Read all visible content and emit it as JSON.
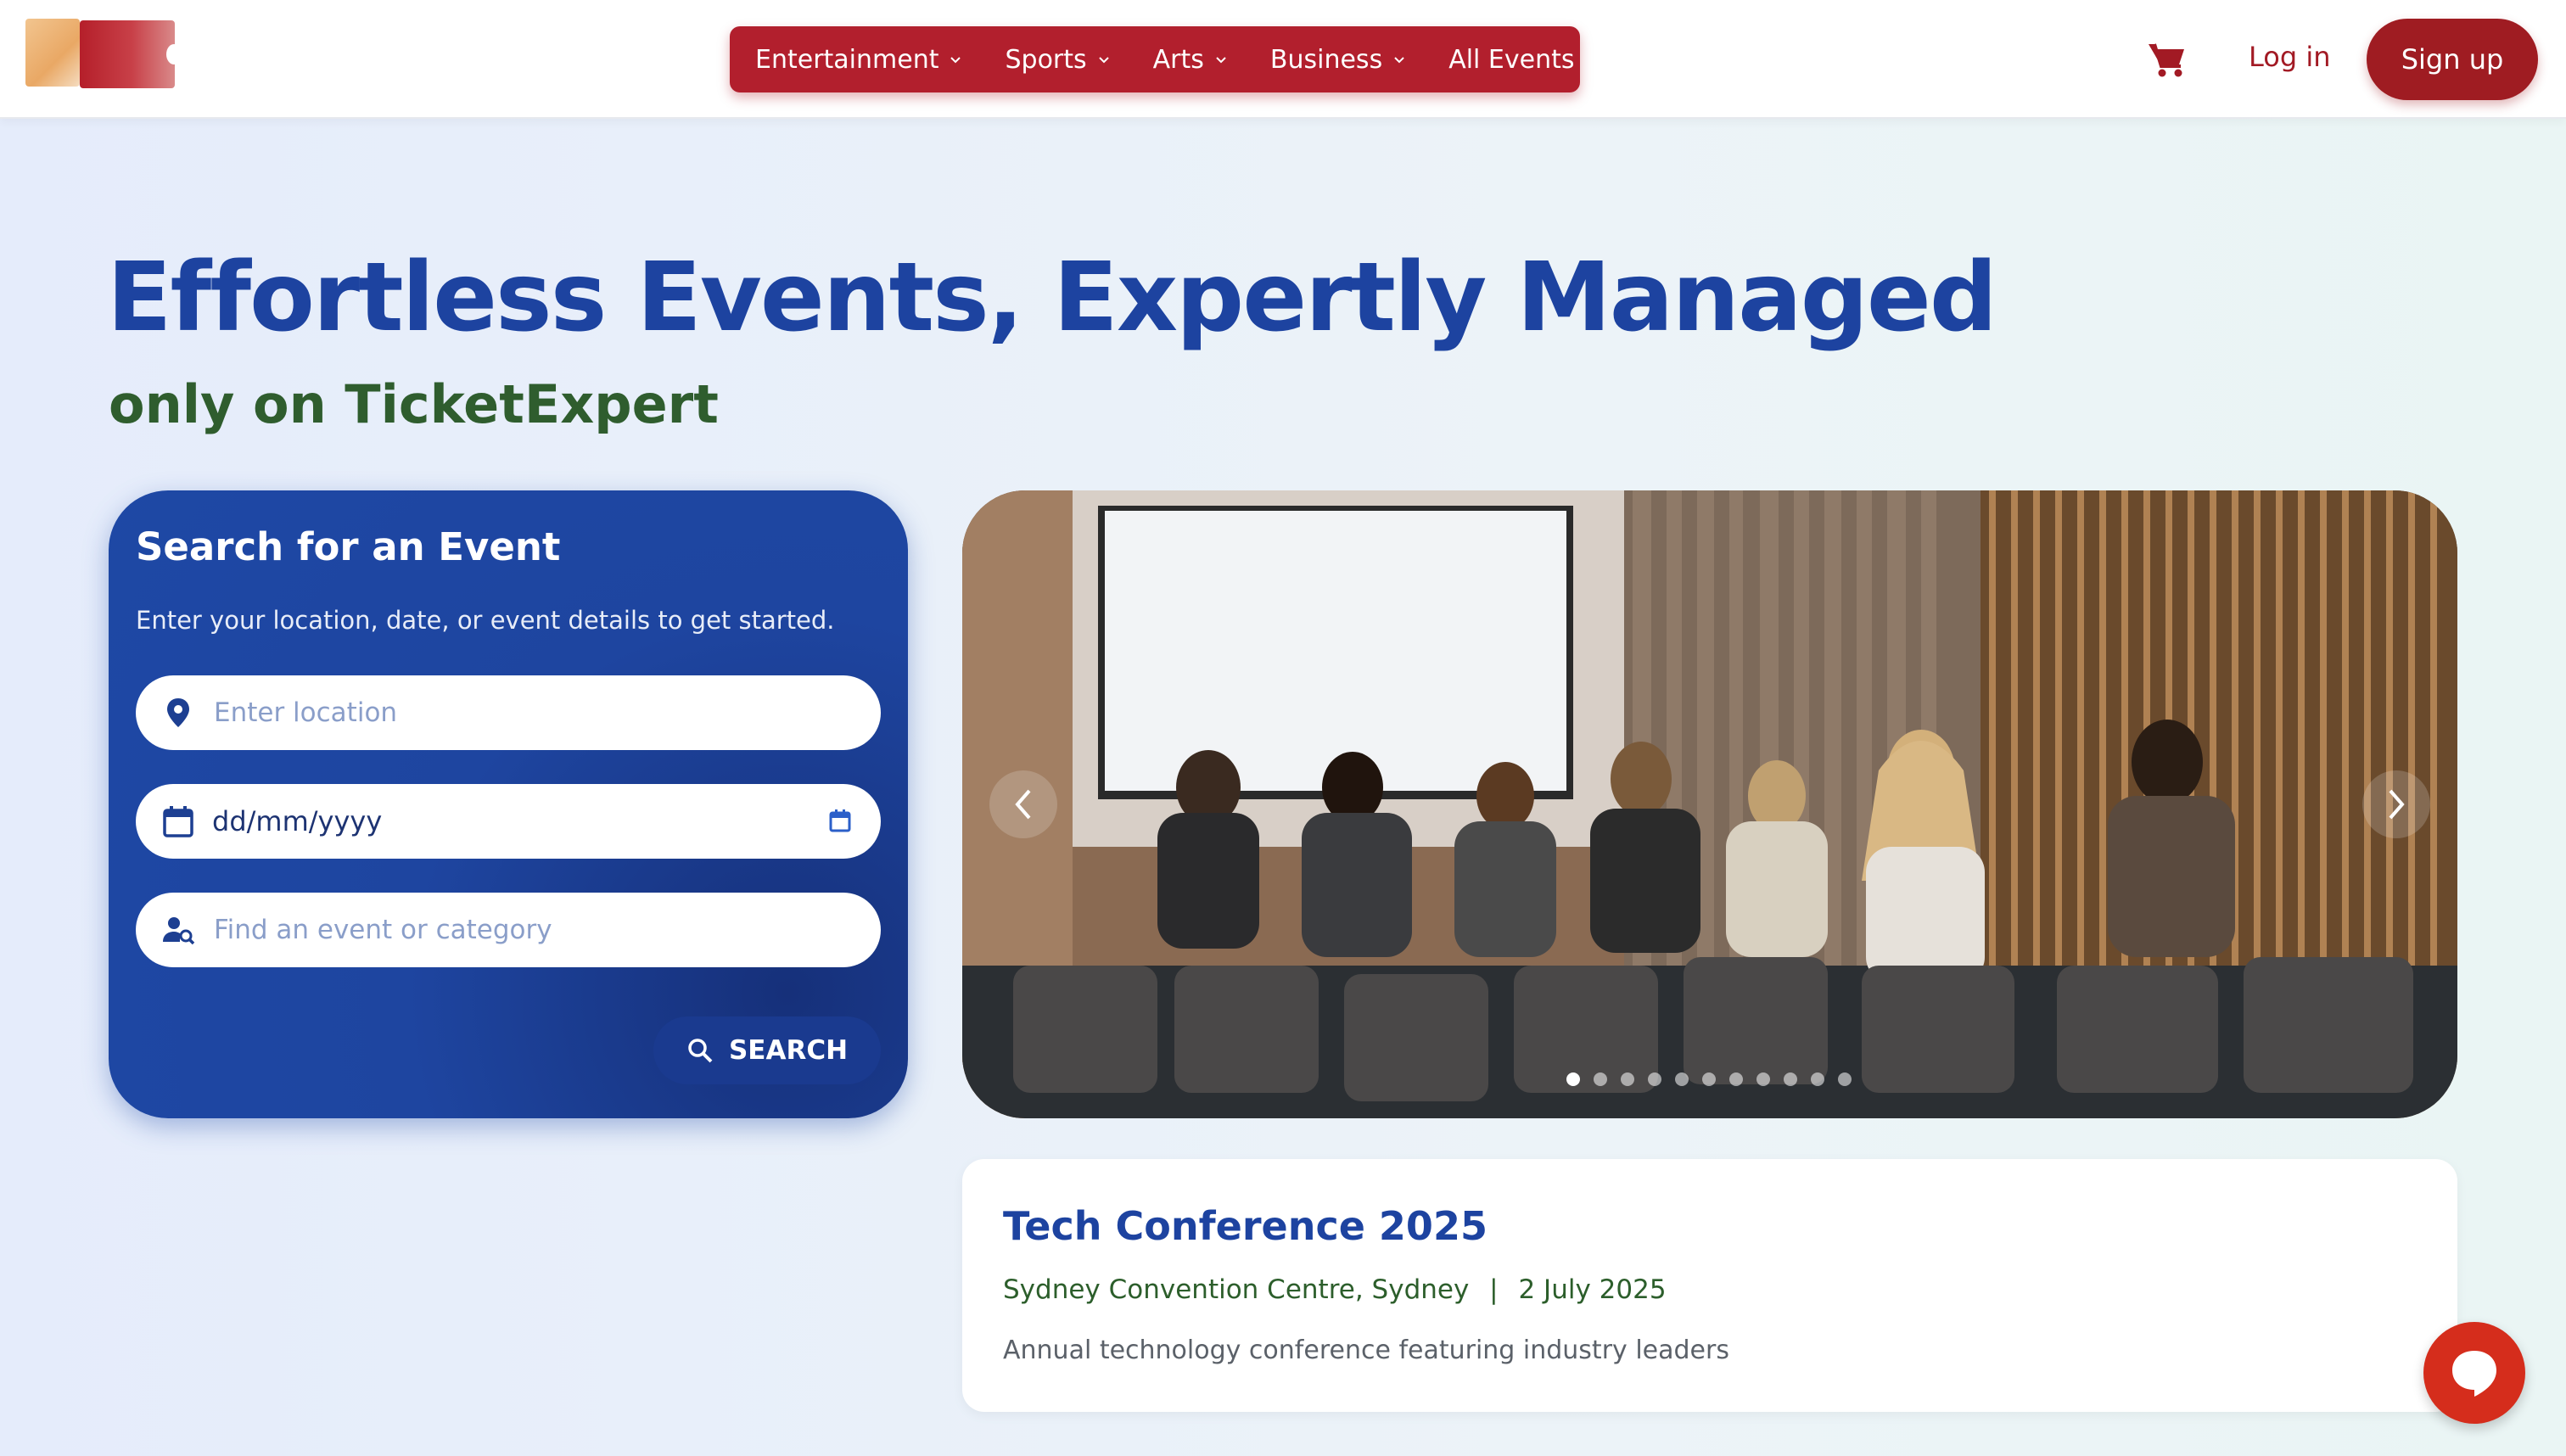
{
  "header": {
    "nav": [
      {
        "label": "Entertainment",
        "has_dropdown": true
      },
      {
        "label": "Sports",
        "has_dropdown": true
      },
      {
        "label": "Arts",
        "has_dropdown": true
      },
      {
        "label": "Business",
        "has_dropdown": true
      },
      {
        "label": "All Events",
        "has_dropdown": false
      }
    ],
    "cart_icon": "shopping-cart-icon",
    "login_label": "Log in",
    "signup_label": "Sign up"
  },
  "hero": {
    "title": "Effortless Events, Expertly Managed",
    "subtitle": "only on TicketExpert"
  },
  "search": {
    "title": "Search for an Event",
    "description": "Enter your location, date, or event details to get started.",
    "location_placeholder": "Enter location",
    "date_value": "dd/mm/yyyy",
    "query_placeholder": "Find an event or category",
    "button_label": "SEARCH"
  },
  "carousel": {
    "slide_count": 11,
    "active_index": 0
  },
  "event": {
    "title": "Tech Conference 2025",
    "venue": "Sydney Convention Centre, Sydney",
    "separator": "|",
    "date": "2 July 2025",
    "description": "Annual technology conference featuring industry leaders"
  },
  "colors": {
    "brand_red": "#b21f2d",
    "brand_blue": "#1d43a0",
    "brand_green": "#2f5d2e"
  }
}
